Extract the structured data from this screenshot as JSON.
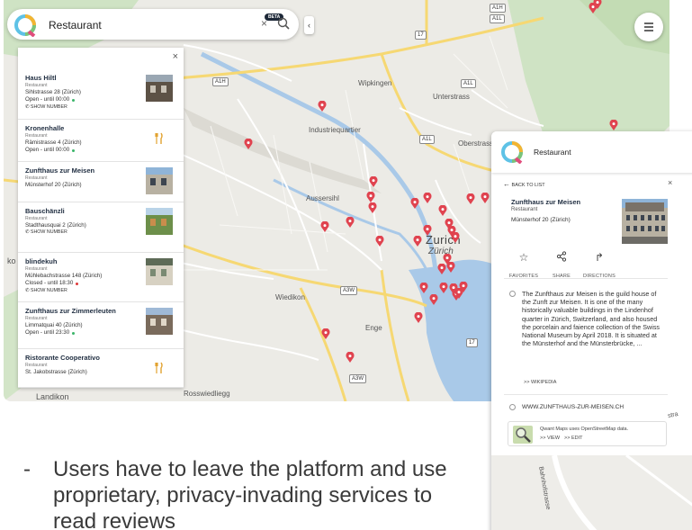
{
  "search": {
    "query": "Restaurant",
    "badge": "BETA",
    "clear_icon": "close-icon",
    "search_icon": "magnifier-icon"
  },
  "map": {
    "labels": {
      "wipkingen": "Wipkingen",
      "unterstrass": "Unterstrass",
      "industriequartier": "Industriequartier",
      "oberstrass": "Oberstrass",
      "aussersihl": "Aussersihl",
      "zurich": "Zurich",
      "zurich_sub": "Zürich",
      "wiedikon": "Wiedikon",
      "enge": "Enge",
      "rosswiedliegg": "Rosswiedliegg",
      "landikon": "Landikon",
      "ko": "ko",
      "stra": "stra"
    },
    "shields": [
      "A1H",
      "A1L",
      "A1L",
      "A3W",
      "A3W",
      "17",
      "17",
      "A1L",
      "A1H"
    ],
    "pin_color": "#e0434f"
  },
  "results": {
    "items": [
      {
        "name": "Haus Hiltl",
        "type": "Restaurant",
        "address": "Sihlstrasse 28 (Zürich)",
        "hours": "Open - until 00:00",
        "status": "open",
        "phone": "SHOW NUMBER",
        "media": "photo"
      },
      {
        "name": "Kronenhalle",
        "type": "Restaurant",
        "address": "Rämistrasse 4 (Zürich)",
        "hours": "Open - until 00:00",
        "status": "open",
        "phone": "",
        "media": "cutlery"
      },
      {
        "name": "Zunfthaus zur Meisen",
        "type": "Restaurant",
        "address": "Münsterhof 20 (Zürich)",
        "hours": "",
        "status": "",
        "phone": "",
        "media": "photo"
      },
      {
        "name": "Bauschänzli",
        "type": "Restaurant",
        "address": "Stadthausquai 2 (Zürich)",
        "hours": "",
        "status": "",
        "phone": "SHOW NUMBER",
        "media": "photo"
      },
      {
        "name": "blindekuh",
        "type": "Restaurant",
        "address": "Mühlebachstrasse 148 (Zürich)",
        "hours": "Closed - until 18:30",
        "status": "closed",
        "phone": "SHOW NUMBER",
        "media": "photo"
      },
      {
        "name": "Zunfthaus zur Zimmerleuten",
        "type": "Restaurant",
        "address": "Limmatquai 40 (Zürich)",
        "hours": "Open - until 23:30",
        "status": "open",
        "phone": "",
        "media": "photo"
      },
      {
        "name": "Ristorante Cooperativo",
        "type": "Restaurant",
        "address": "St. Jakobstrasse (Zürich)",
        "hours": "",
        "status": "",
        "phone": "",
        "media": "cutlery"
      }
    ]
  },
  "detail": {
    "query": "Restaurant",
    "back_label": "BACK TO LIST",
    "name": "Zunfthaus zur Meisen",
    "type": "Restaurant",
    "address": "Münsterhof 20 (Zürich)",
    "actions": [
      {
        "label": "FAVORITES",
        "icon": "star-icon"
      },
      {
        "label": "SHARE",
        "icon": "share-icon"
      },
      {
        "label": "DIRECTIONS",
        "icon": "directions-icon"
      }
    ],
    "description": "The Zunfthaus zur Meisen is the guild house of the Zunft zur Meisen. It is one of the many historically valuable buildings in the Lindenhof quarter in Zürich, Switzerland, and also housed the porcelain and faience collection of the Swiss National Museum by April 2018. It is situated at the Münsterhof and the Münsterbrücke, ...",
    "wikipedia_link": ">> WIKIPEDIA",
    "website": "WWW.ZUNFTHAUS-ZUR-MEISEN.CH",
    "osm_note": "Qwant Maps uses OpenStreetMap data.",
    "osm_view": ">> VIEW",
    "osm_edit": ">> EDIT",
    "street_label": "Bahnhofstrasse"
  },
  "caption": {
    "dash": "-",
    "text": "Users have to leave the platform and use proprietary, privacy-invading services to read reviews"
  }
}
